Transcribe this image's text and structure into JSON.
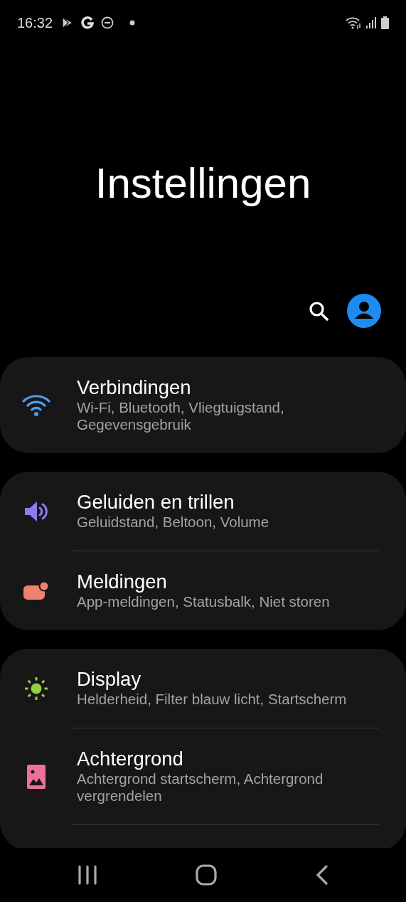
{
  "status_bar": {
    "time": "16:32",
    "left_icons": [
      {
        "kind": "play"
      },
      {
        "kind": "google"
      },
      {
        "kind": "dnd"
      },
      {
        "kind": "dot"
      }
    ],
    "right_icons": [
      {
        "kind": "wifi"
      },
      {
        "kind": "signal"
      },
      {
        "kind": "battery"
      }
    ]
  },
  "title": "Instellingen",
  "actions": [
    {
      "kind": "search"
    },
    {
      "kind": "account"
    }
  ],
  "groups": [
    {
      "items": [
        {
          "kind": "wifi",
          "color": "#4d9ef0",
          "title": "Verbindingen",
          "subtitle": "Wi-Fi, Bluetooth, Vliegtuigstand, Gegevensgebruik"
        }
      ]
    },
    {
      "items": [
        {
          "kind": "sound",
          "color": "#8b7cf0",
          "title": "Geluiden en trillen",
          "subtitle": "Geluidstand, Beltoon, Volume"
        },
        {
          "kind": "notification",
          "color": "#f08070",
          "title": "Meldingen",
          "subtitle": "App-meldingen, Statusbalk, Niet storen"
        }
      ]
    },
    {
      "items": [
        {
          "kind": "display",
          "color": "#8fd13f",
          "title": "Display",
          "subtitle": "Helderheid, Filter blauw licht, Startscherm"
        },
        {
          "kind": "wallpaper",
          "color": "#ee6f9c",
          "title": "Achtergrond",
          "subtitle": "Achtergrond startscherm, Achtergrond vergrendelen"
        }
      ],
      "more_below": true
    }
  ],
  "nav_bar": [
    {
      "kind": "recents"
    },
    {
      "kind": "home"
    },
    {
      "kind": "back"
    }
  ]
}
